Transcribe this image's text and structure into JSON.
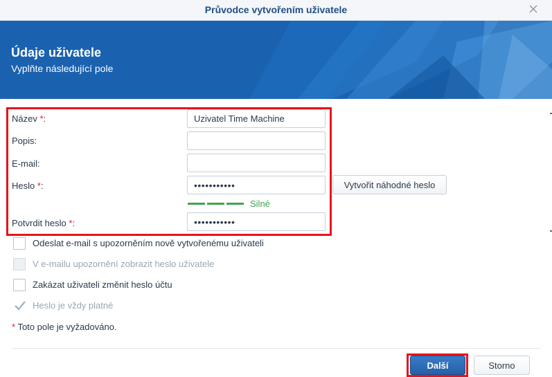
{
  "window": {
    "title": "Průvodce vytvořením uživatele",
    "close_icon": "close-icon"
  },
  "banner": {
    "heading": "Údaje uživatele",
    "subheading": "Vyplňte následující pole"
  },
  "form": {
    "name": {
      "label": "Název",
      "required_mark": "*",
      "colon": ":",
      "value": "Uzivatel Time Machine"
    },
    "description": {
      "label": "Popis:",
      "value": ""
    },
    "email": {
      "label": "E-mail:",
      "value": ""
    },
    "password": {
      "label": "Heslo",
      "required_mark": "*",
      "colon": ":",
      "value": "•••••••••••"
    },
    "generate_button": "Vytvořit náhodné heslo",
    "strength_label": "Silné",
    "strength_color": "#3fa34d",
    "confirm": {
      "label": "Potvrdit heslo",
      "required_mark": "*",
      "colon": ":",
      "value": "•••••••••••"
    }
  },
  "options": [
    {
      "label": "Odeslat e-mail s upozorněním nově vytvořenému uživateli",
      "checked": false,
      "disabled": false
    },
    {
      "label": "V e-mailu upozornění zobrazit heslo uživatele",
      "checked": false,
      "disabled": true
    },
    {
      "label": "Zakázat uživateli změnit heslo účtu",
      "checked": false,
      "disabled": false
    },
    {
      "label": "Heslo je vždy platné",
      "checked": true,
      "disabled": true
    }
  ],
  "required_note": {
    "mark": "*",
    "text": "Toto pole je vyžadováno."
  },
  "footer": {
    "next_label": "Další",
    "cancel_label": "Storno"
  },
  "colors": {
    "accent": "#2460a7",
    "banner": "#1a62b0",
    "required": "#d92020",
    "highlight": "#e8131b"
  }
}
